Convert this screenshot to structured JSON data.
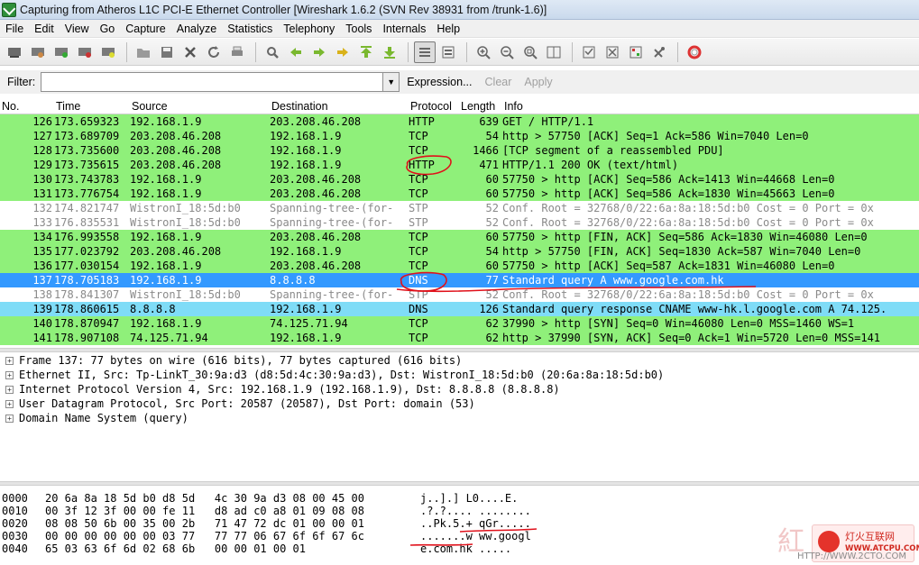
{
  "window": {
    "title": "Capturing from Atheros L1C PCI-E Ethernet Controller    [Wireshark 1.6.2  (SVN Rev 38931 from /trunk-1.6)]"
  },
  "menu": [
    {
      "label": "File"
    },
    {
      "label": "Edit"
    },
    {
      "label": "View"
    },
    {
      "label": "Go"
    },
    {
      "label": "Capture"
    },
    {
      "label": "Analyze"
    },
    {
      "label": "Statistics"
    },
    {
      "label": "Telephony"
    },
    {
      "label": "Tools"
    },
    {
      "label": "Internals"
    },
    {
      "label": "Help"
    }
  ],
  "toolbar": {
    "icons": [
      "interfaces-icon",
      "options-icon",
      "start-icon",
      "stop-icon",
      "restart-icon",
      "open-icon",
      "save-icon",
      "close-icon",
      "reload-icon",
      "print-icon",
      "find-icon",
      "back-icon",
      "forward-icon",
      "goto-icon",
      "first-icon",
      "last-icon",
      "colorize-icon",
      "autoscroll-icon",
      "zoom-in-icon",
      "zoom-out-icon",
      "zoom-normal-icon",
      "resize-columns-icon",
      "capture-filters-icon",
      "display-filters-icon",
      "coloring-rules-icon",
      "preferences-icon",
      "help-icon"
    ]
  },
  "filter": {
    "label": "Filter:",
    "value": "",
    "expression": "Expression...",
    "clear": "Clear",
    "apply": "Apply"
  },
  "columns": [
    "No.",
    "Time",
    "Source",
    "Destination",
    "Protocol",
    "Length",
    "Info"
  ],
  "packets": [
    {
      "no": "126",
      "time": "173.659323",
      "src": "192.168.1.9",
      "dst": "203.208.46.208",
      "proto": "HTTP",
      "len": "639",
      "info": "GET / HTTP/1.1",
      "style": "green"
    },
    {
      "no": "127",
      "time": "173.689709",
      "src": "203.208.46.208",
      "dst": "192.168.1.9",
      "proto": "TCP",
      "len": "54",
      "info": "http > 57750 [ACK] Seq=1 Ack=586 Win=7040 Len=0",
      "style": "green"
    },
    {
      "no": "128",
      "time": "173.735600",
      "src": "203.208.46.208",
      "dst": "192.168.1.9",
      "proto": "TCP",
      "len": "1466",
      "info": "[TCP segment of a reassembled PDU]",
      "style": "green"
    },
    {
      "no": "129",
      "time": "173.735615",
      "src": "203.208.46.208",
      "dst": "192.168.1.9",
      "proto": "HTTP",
      "len": "471",
      "info": "HTTP/1.1 200 OK  (text/html)",
      "style": "green"
    },
    {
      "no": "130",
      "time": "173.743783",
      "src": "192.168.1.9",
      "dst": "203.208.46.208",
      "proto": "TCP",
      "len": "60",
      "info": "57750 > http [ACK] Seq=586 Ack=1413 Win=44668 Len=0",
      "style": "green"
    },
    {
      "no": "131",
      "time": "173.776754",
      "src": "192.168.1.9",
      "dst": "203.208.46.208",
      "proto": "TCP",
      "len": "60",
      "info": "57750 > http [ACK] Seq=586 Ack=1830 Win=45663 Len=0",
      "style": "green"
    },
    {
      "no": "132",
      "time": "174.821747",
      "src": "WistronI_18:5d:b0",
      "dst": "Spanning-tree-(for-",
      "proto": "STP",
      "len": "52",
      "info": "Conf. Root = 32768/0/22:6a:8a:18:5d:b0  Cost = 0  Port = 0x",
      "style": "white"
    },
    {
      "no": "133",
      "time": "176.835531",
      "src": "WistronI_18:5d:b0",
      "dst": "Spanning-tree-(for-",
      "proto": "STP",
      "len": "52",
      "info": "Conf. Root = 32768/0/22:6a:8a:18:5d:b0  Cost = 0  Port = 0x",
      "style": "white"
    },
    {
      "no": "134",
      "time": "176.993558",
      "src": "192.168.1.9",
      "dst": "203.208.46.208",
      "proto": "TCP",
      "len": "60",
      "info": "57750 > http [FIN, ACK] Seq=586 Ack=1830 Win=46080 Len=0",
      "style": "green"
    },
    {
      "no": "135",
      "time": "177.023792",
      "src": "203.208.46.208",
      "dst": "192.168.1.9",
      "proto": "TCP",
      "len": "54",
      "info": "http > 57750 [FIN, ACK] Seq=1830 Ack=587 Win=7040 Len=0",
      "style": "green"
    },
    {
      "no": "136",
      "time": "177.030154",
      "src": "192.168.1.9",
      "dst": "203.208.46.208",
      "proto": "TCP",
      "len": "60",
      "info": "57750 > http [ACK] Seq=587 Ack=1831 Win=46080 Len=0",
      "style": "green"
    },
    {
      "no": "137",
      "time": "178.705183",
      "src": "192.168.1.9",
      "dst": "8.8.8.8",
      "proto": "DNS",
      "len": "77",
      "info": "Standard query A www.google.com.hk",
      "style": "selected"
    },
    {
      "no": "138",
      "time": "178.841307",
      "src": "WistronI_18:5d:b0",
      "dst": "Spanning-tree-(for-",
      "proto": "STP",
      "len": "52",
      "info": "Conf. Root = 32768/0/22:6a:8a:18:5d:b0  Cost = 0  Port = 0x",
      "style": "white"
    },
    {
      "no": "139",
      "time": "178.860615",
      "src": "8.8.8.8",
      "dst": "192.168.1.9",
      "proto": "DNS",
      "len": "126",
      "info": "Standard query response CNAME www-hk.l.google.com A 74.125.",
      "style": "blue"
    },
    {
      "no": "140",
      "time": "178.870947",
      "src": "192.168.1.9",
      "dst": "74.125.71.94",
      "proto": "TCP",
      "len": "62",
      "info": "37990 > http [SYN] Seq=0 Win=46080 Len=0 MSS=1460 WS=1",
      "style": "green"
    },
    {
      "no": "141",
      "time": "178.907108",
      "src": "74.125.71.94",
      "dst": "192.168.1.9",
      "proto": "TCP",
      "len": "62",
      "info": "http > 37990 [SYN, ACK] Seq=0 Ack=1 Win=5720 Len=0 MSS=141",
      "style": "green"
    }
  ],
  "details": [
    "Frame 137: 77 bytes on wire (616 bits), 77 bytes captured (616 bits)",
    "Ethernet II, Src: Tp-LinkT_30:9a:d3 (d8:5d:4c:30:9a:d3), Dst: WistronI_18:5d:b0 (20:6a:8a:18:5d:b0)",
    "Internet Protocol Version 4, Src: 192.168.1.9 (192.168.1.9), Dst: 8.8.8.8 (8.8.8.8)",
    "User Datagram Protocol, Src Port: 20587 (20587), Dst Port: domain (53)",
    "Domain Name System (query)"
  ],
  "hex": [
    {
      "off": "0000",
      "hex": "20 6a 8a 18 5d b0 d8 5d   4c 30 9a d3 08 00 45 00",
      "ascii": "j..].] L0....E."
    },
    {
      "off": "0010",
      "hex": "00 3f 12 3f 00 00 fe 11   d8 ad c0 a8 01 09 08 08",
      "ascii": ".?.?.... ........"
    },
    {
      "off": "0020",
      "hex": "08 08 50 6b 00 35 00 2b   71 47 72 dc 01 00 00 01",
      "ascii": "..Pk.5.+ qGr....."
    },
    {
      "off": "0030",
      "hex": "00 00 00 00 00 00 03 77   77 77 06 67 6f 6f 67 6c",
      "ascii": ".......w ww.googl"
    },
    {
      "off": "0040",
      "hex": "65 03 63 6f 6d 02 68 6b   00 00 01 00 01",
      "ascii": "e.com.hk ....."
    }
  ],
  "watermark": {
    "brand": "灯火互联网",
    "url": "WWW.ATCPU.COM",
    "url2": "HTTP://WWW.2CTO.COM"
  },
  "colors": {
    "green": "#8ff07a",
    "blue": "#7fdcf7",
    "selected": "#3399ff",
    "annotation": "#e0111b"
  }
}
